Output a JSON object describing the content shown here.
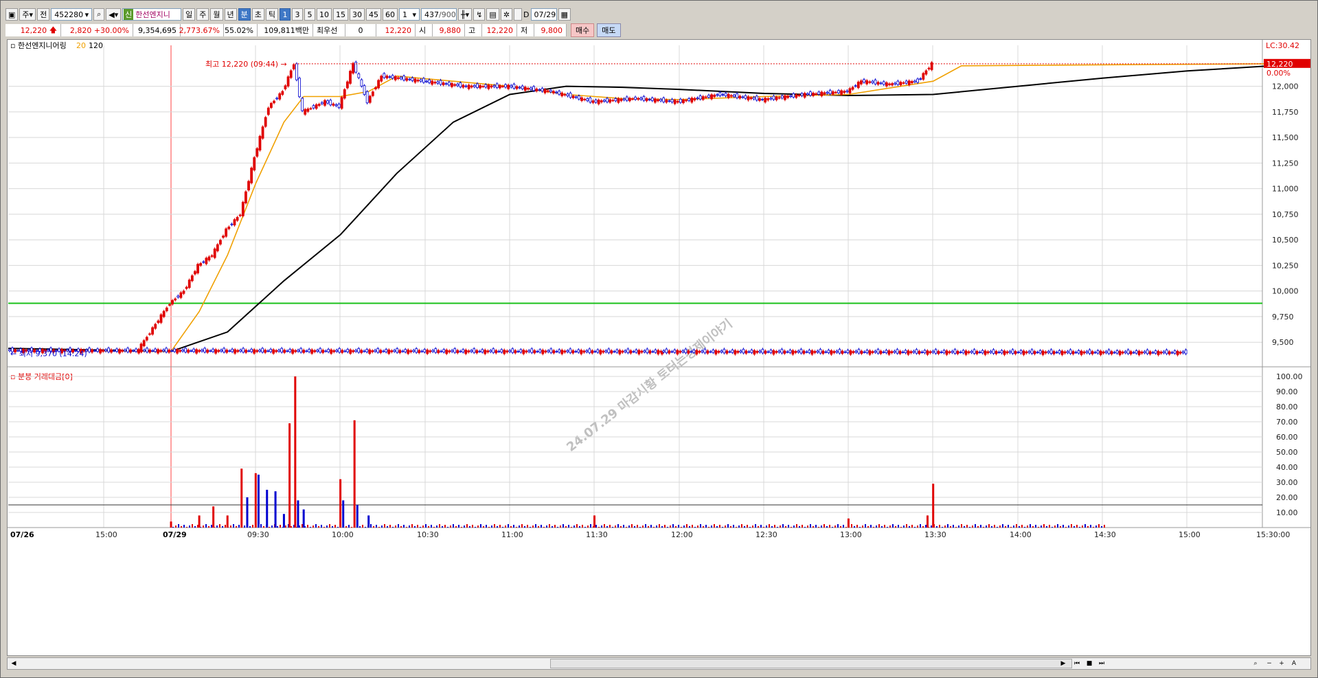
{
  "toolbar": {
    "market_btn": "주",
    "prev_btn": "전",
    "code": "452280",
    "shin_badge": "신",
    "name": "한선엔지니",
    "periods": [
      "일",
      "주",
      "월",
      "년",
      "분",
      "초",
      "틱"
    ],
    "selected_period": "분",
    "intervals": [
      "1",
      "3",
      "5",
      "10",
      "15",
      "30",
      "45",
      "60"
    ],
    "selected_interval": "1",
    "interval_value": "1",
    "count": "437",
    "count_total": "/900",
    "date_field": "07/29",
    "d_label": "D"
  },
  "quote": {
    "price": "12,220",
    "change": "2,820",
    "change_pct": "+30.00%",
    "volume": "9,354,695",
    "vol_ratio": "2,773.67%",
    "turnover_ratio": "55.02%",
    "amount": "109,811백만",
    "best_label": "최우선",
    "best_value": "0",
    "best_price": "12,220",
    "open_label": "시",
    "open": "9,880",
    "high_label": "고",
    "high": "12,220",
    "low_label": "저",
    "low": "9,800",
    "buy_btn": "매수",
    "sell_btn": "매도"
  },
  "colors": {
    "up": "#e00000",
    "down": "#0000d0",
    "ma20": "#f0a000",
    "ma120": "#000000",
    "ref_line": "#19c019",
    "grid": "#d8d8d8"
  },
  "chart_data": [
    {
      "type": "candlestick",
      "title": "한선엔지니어링",
      "ma_labels": [
        "20",
        "120"
      ],
      "lc_label": "LC:30.42",
      "price_tag": "12,220",
      "pct_tag": "0.00%",
      "high_annotation": "최고 12,220 (09:44)",
      "low_annotation": "최저 9,370 (14:24)",
      "watermark": "24.07.29 마감시황   토터는경제이야기",
      "ylim": [
        9300,
        12400
      ],
      "yticks": [
        9500,
        9750,
        10000,
        10250,
        10500,
        10750,
        11000,
        11250,
        11500,
        11750,
        12000,
        12220
      ],
      "ytick_labels": [
        "9,500",
        "9,750",
        "10,000",
        "10,250",
        "10,500",
        "10,750",
        "11,000",
        "11,250",
        "11,500",
        "11,750",
        "12,000"
      ],
      "ref_line_value": 9880,
      "x_labels": [
        "07/26",
        "15:00",
        "07/29",
        "09:30",
        "10:00",
        "10:30",
        "11:00",
        "11:30",
        "12:00",
        "12:30",
        "13:00",
        "13:30",
        "14:00",
        "14:30",
        "15:00",
        "15:30:00"
      ],
      "price_path": [
        {
          "t": "07/26 14:40",
          "v": 9420
        },
        {
          "t": "15:00",
          "v": 9400
        },
        {
          "t": "15:20",
          "v": 9390
        },
        {
          "t": "09:00",
          "v": 9880
        },
        {
          "t": "09:05",
          "v": 10000
        },
        {
          "t": "09:10",
          "v": 10250
        },
        {
          "t": "09:15",
          "v": 10350
        },
        {
          "t": "09:20",
          "v": 10600
        },
        {
          "t": "09:25",
          "v": 10750
        },
        {
          "t": "09:30",
          "v": 11300
        },
        {
          "t": "09:35",
          "v": 11800
        },
        {
          "t": "09:40",
          "v": 11950
        },
        {
          "t": "09:44",
          "v": 12220
        },
        {
          "t": "09:47",
          "v": 11750
        },
        {
          "t": "09:55",
          "v": 11850
        },
        {
          "t": "10:00",
          "v": 11800
        },
        {
          "t": "10:05",
          "v": 12220
        },
        {
          "t": "10:10",
          "v": 11850
        },
        {
          "t": "10:15",
          "v": 12100
        },
        {
          "t": "10:30",
          "v": 12050
        },
        {
          "t": "10:45",
          "v": 12000
        },
        {
          "t": "11:00",
          "v": 12000
        },
        {
          "t": "11:15",
          "v": 11950
        },
        {
          "t": "11:30",
          "v": 11850
        },
        {
          "t": "11:45",
          "v": 11880
        },
        {
          "t": "12:00",
          "v": 11850
        },
        {
          "t": "12:15",
          "v": 11920
        },
        {
          "t": "12:30",
          "v": 11870
        },
        {
          "t": "12:45",
          "v": 11920
        },
        {
          "t": "13:00",
          "v": 11950
        },
        {
          "t": "13:05",
          "v": 12050
        },
        {
          "t": "13:15",
          "v": 12020
        },
        {
          "t": "13:25",
          "v": 12050
        },
        {
          "t": "13:30",
          "v": 12220
        }
      ],
      "ma20_path": [
        {
          "t": "07/26 14:40",
          "v": 9420
        },
        {
          "t": "09:00",
          "v": 9410
        },
        {
          "t": "09:10",
          "v": 9800
        },
        {
          "t": "09:20",
          "v": 10350
        },
        {
          "t": "09:30",
          "v": 11050
        },
        {
          "t": "09:40",
          "v": 11650
        },
        {
          "t": "09:47",
          "v": 11900
        },
        {
          "t": "10:00",
          "v": 11900
        },
        {
          "t": "10:10",
          "v": 11950
        },
        {
          "t": "10:20",
          "v": 12100
        },
        {
          "t": "10:40",
          "v": 12050
        },
        {
          "t": "11:00",
          "v": 12000
        },
        {
          "t": "11:20",
          "v": 11920
        },
        {
          "t": "11:40",
          "v": 11880
        },
        {
          "t": "12:00",
          "v": 11870
        },
        {
          "t": "12:30",
          "v": 11900
        },
        {
          "t": "13:00",
          "v": 11920
        },
        {
          "t": "13:30",
          "v": 12050
        },
        {
          "t": "13:40",
          "v": 12200
        },
        {
          "t": "15:30",
          "v": 12220
        }
      ],
      "ma120_path": [
        {
          "t": "07/26 14:40",
          "v": 9440
        },
        {
          "t": "09:00",
          "v": 9410
        },
        {
          "t": "09:20",
          "v": 9600
        },
        {
          "t": "09:40",
          "v": 10100
        },
        {
          "t": "10:00",
          "v": 10550
        },
        {
          "t": "10:20",
          "v": 11150
        },
        {
          "t": "10:40",
          "v": 11650
        },
        {
          "t": "11:00",
          "v": 11920
        },
        {
          "t": "11:20",
          "v": 12000
        },
        {
          "t": "11:40",
          "v": 11990
        },
        {
          "t": "12:00",
          "v": 11970
        },
        {
          "t": "12:30",
          "v": 11930
        },
        {
          "t": "13:00",
          "v": 11910
        },
        {
          "t": "13:30",
          "v": 11920
        },
        {
          "t": "14:00",
          "v": 12000
        },
        {
          "t": "14:30",
          "v": 12080
        },
        {
          "t": "15:00",
          "v": 12150
        },
        {
          "t": "15:30",
          "v": 12200
        }
      ]
    },
    {
      "type": "bar",
      "title": "분봉 거래대금[0]",
      "ylim": [
        0,
        100
      ],
      "ytick_labels": [
        "10.00",
        "20.00",
        "30.00",
        "40.00",
        "50.00",
        "60.00",
        "70.00",
        "80.00",
        "90.00",
        "100.00"
      ],
      "ref_line_value": 15,
      "series": [
        {
          "t": "09:00",
          "v": 4,
          "dir": "up"
        },
        {
          "t": "09:10",
          "v": 8,
          "dir": "up"
        },
        {
          "t": "09:15",
          "v": 14,
          "dir": "up"
        },
        {
          "t": "09:20",
          "v": 8,
          "dir": "up"
        },
        {
          "t": "09:25",
          "v": 39,
          "dir": "up"
        },
        {
          "t": "09:27",
          "v": 20,
          "dir": "down"
        },
        {
          "t": "09:30",
          "v": 36,
          "dir": "up"
        },
        {
          "t": "09:31",
          "v": 35,
          "dir": "down"
        },
        {
          "t": "09:34",
          "v": 25,
          "dir": "down"
        },
        {
          "t": "09:37",
          "v": 24,
          "dir": "down"
        },
        {
          "t": "09:40",
          "v": 9,
          "dir": "down"
        },
        {
          "t": "09:42",
          "v": 69,
          "dir": "up"
        },
        {
          "t": "09:44",
          "v": 100,
          "dir": "up"
        },
        {
          "t": "09:45",
          "v": 18,
          "dir": "down"
        },
        {
          "t": "09:47",
          "v": 12,
          "dir": "down"
        },
        {
          "t": "10:00",
          "v": 32,
          "dir": "up"
        },
        {
          "t": "10:01",
          "v": 18,
          "dir": "down"
        },
        {
          "t": "10:05",
          "v": 71,
          "dir": "up"
        },
        {
          "t": "10:06",
          "v": 15,
          "dir": "down"
        },
        {
          "t": "10:10",
          "v": 8,
          "dir": "down"
        },
        {
          "t": "11:30",
          "v": 8,
          "dir": "up"
        },
        {
          "t": "13:00",
          "v": 6,
          "dir": "up"
        },
        {
          "t": "13:28",
          "v": 8,
          "dir": "up"
        },
        {
          "t": "13:30",
          "v": 29,
          "dir": "up"
        }
      ]
    }
  ]
}
